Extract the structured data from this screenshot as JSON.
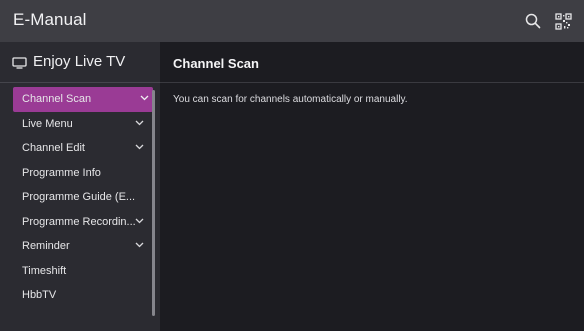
{
  "app": {
    "title": "E-Manual"
  },
  "toolbar": {
    "search_icon": "search-icon",
    "qr_icon": "qr-code-icon"
  },
  "sidebar": {
    "header": {
      "icon": "tv-icon",
      "label": "Enjoy Live TV"
    },
    "items": [
      {
        "label": "Channel Scan",
        "has_chevron": true,
        "active": true
      },
      {
        "label": "Live Menu",
        "has_chevron": true
      },
      {
        "label": "Channel Edit",
        "has_chevron": true
      },
      {
        "label": "Programme Info",
        "has_chevron": false
      },
      {
        "label": "Programme Guide (E...",
        "has_chevron": false
      },
      {
        "label": "Programme Recordin...",
        "has_chevron": true
      },
      {
        "label": "Reminder",
        "has_chevron": true
      },
      {
        "label": "Timeshift",
        "has_chevron": false
      },
      {
        "label": "HbbTV",
        "has_chevron": false
      }
    ]
  },
  "main": {
    "title": "Channel Scan",
    "body": "You can scan for channels automatically or manually."
  },
  "colors": {
    "active_item": "#9a3b95",
    "titlebar": "#3e3e44",
    "sidebar": "#2b2b31",
    "content": "#1c1c21"
  }
}
